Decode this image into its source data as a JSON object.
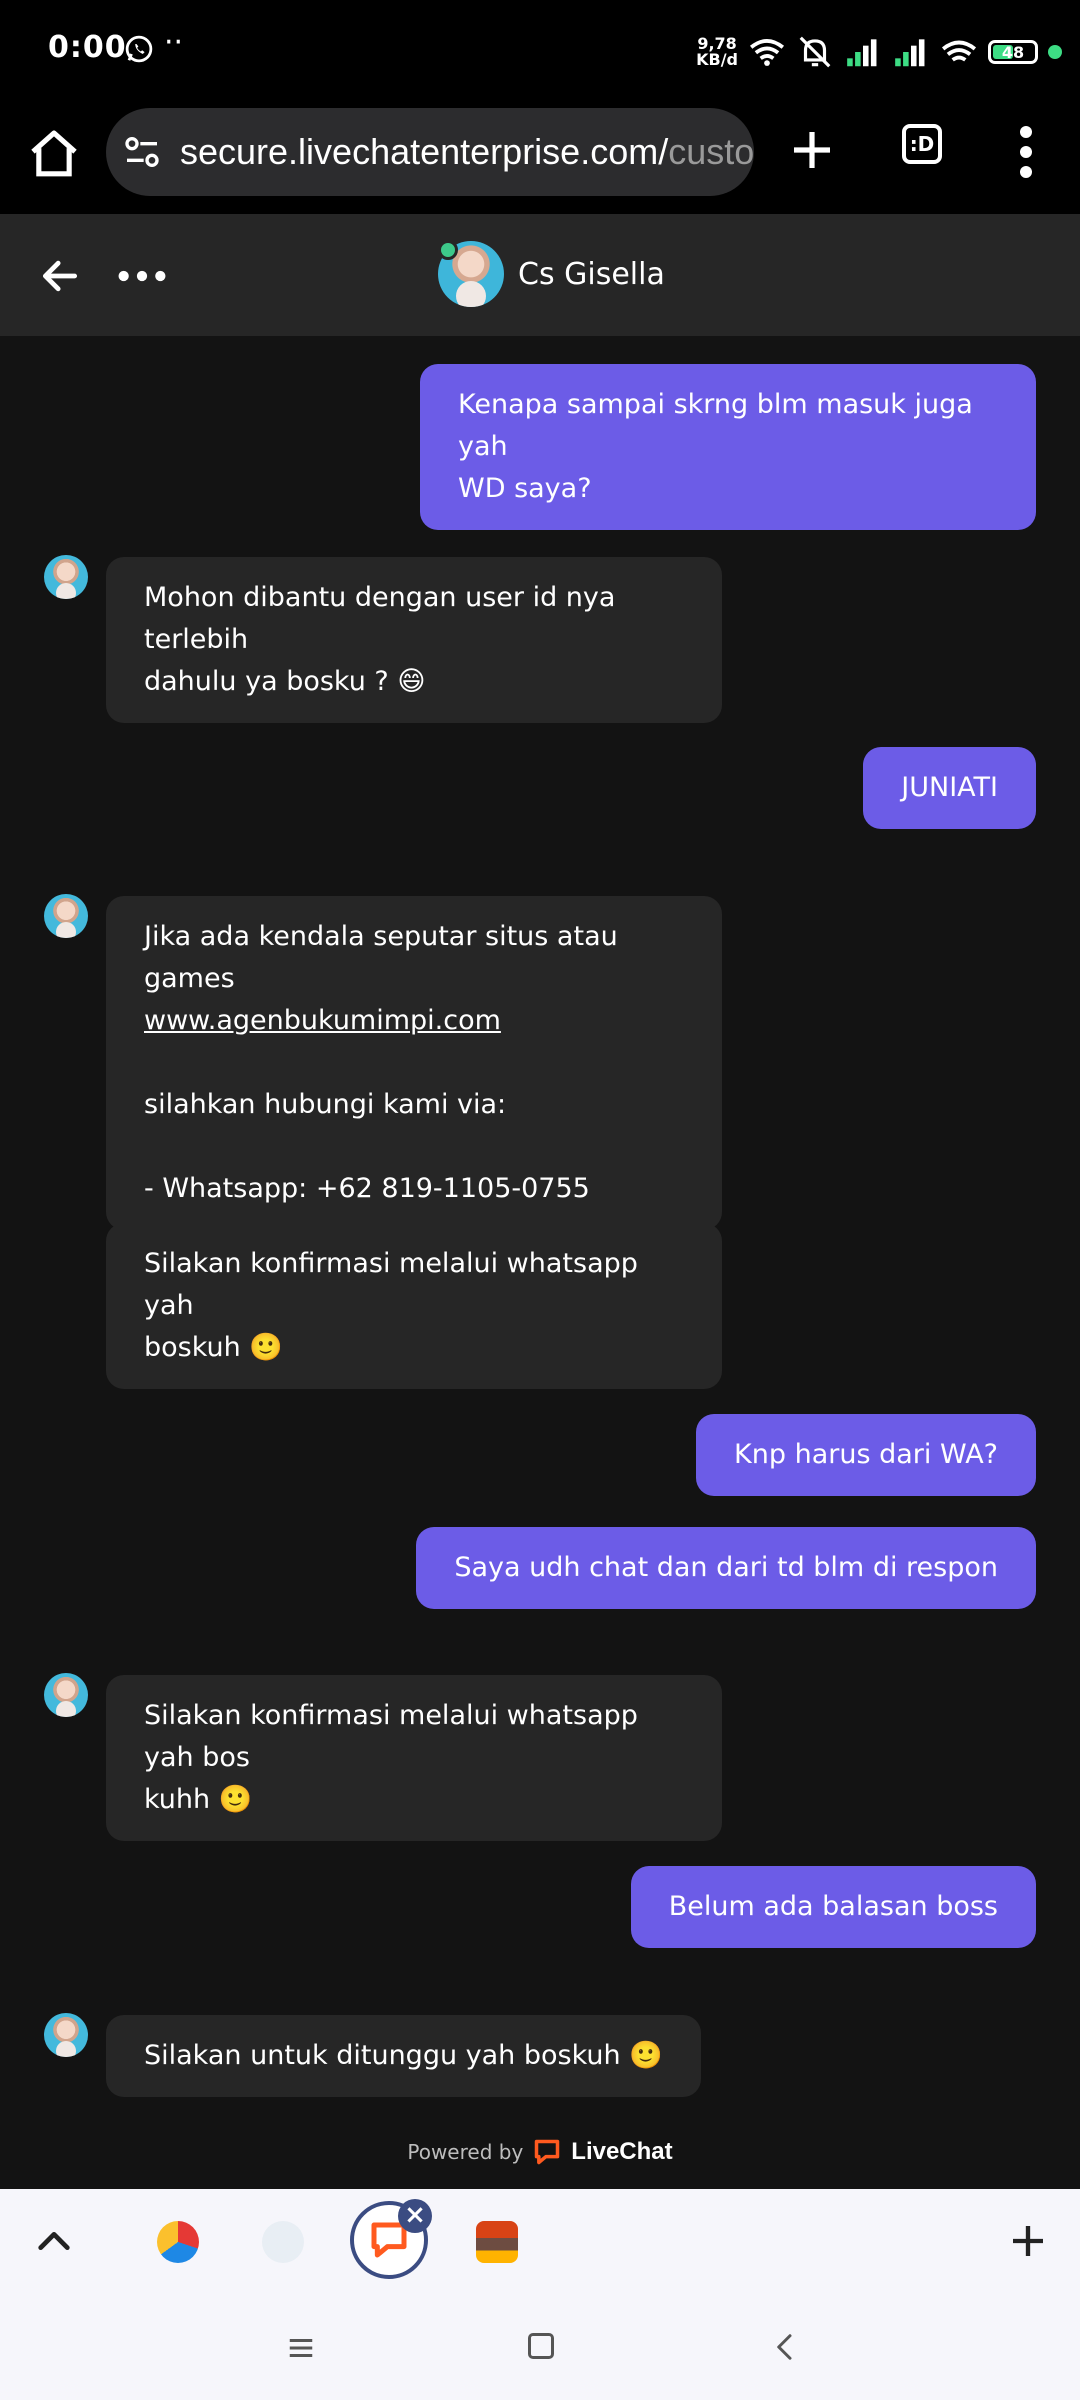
{
  "status_bar": {
    "time": "0:00",
    "dots": "··",
    "net_speed_value": "9,78",
    "net_speed_unit": "KB/d",
    "battery": "48"
  },
  "browser": {
    "url_visible": "secure.livechatenterprise.com/",
    "url_faded": "custo",
    "tabs_label": ":D"
  },
  "chat": {
    "agent_name": "Cs Gisella",
    "messages": [
      {
        "from": "visitor",
        "lines": [
          "Kenapa sampai skrng blm masuk juga yah",
          "WD saya?"
        ]
      },
      {
        "from": "agent",
        "lines": [
          "Mohon dibantu dengan user id nya terlebih",
          "dahulu ya bosku ? 😄"
        ]
      },
      {
        "from": "visitor",
        "lines": [
          "JUNIATI"
        ]
      },
      {
        "from": "agent",
        "lines": [
          "Jika ada kendala seputar situs atau games",
          "www.agenbukumimpi.com",
          "silahkan hubungi kami via:",
          "- Whatsapp: +62 819-1105-0755"
        ]
      },
      {
        "from": "agent",
        "lines": [
          "Silakan konfirmasi melalui whatsapp yah",
          "boskuh 🙂"
        ]
      },
      {
        "from": "visitor",
        "lines": [
          "Knp harus dari WA?"
        ]
      },
      {
        "from": "visitor",
        "lines": [
          "Saya udh chat dan dari td blm di respon"
        ]
      },
      {
        "from": "agent",
        "lines": [
          "Silakan konfirmasi melalui whatsapp yah bos",
          "kuhh 🙂"
        ]
      },
      {
        "from": "visitor",
        "lines": [
          "Belum ada balasan boss"
        ]
      },
      {
        "from": "agent",
        "lines": [
          "Silakan untuk ditunggu yah boskuh 🙂"
        ]
      }
    ],
    "powered_by": "Powered by",
    "brand": "LiveChat"
  },
  "colors": {
    "visitor_bubble": "#6c5ce7",
    "agent_bubble": "#262626",
    "chat_bg": "#131313",
    "online": "#3dc98a"
  },
  "icons": [
    "home-icon",
    "site-settings-icon",
    "new-tab-plus-icon",
    "tab-switcher-icon",
    "overflow-menu-icon",
    "back-arrow-icon",
    "more-dots-icon",
    "chevron-up-icon",
    "close-icon",
    "add-icon"
  ]
}
